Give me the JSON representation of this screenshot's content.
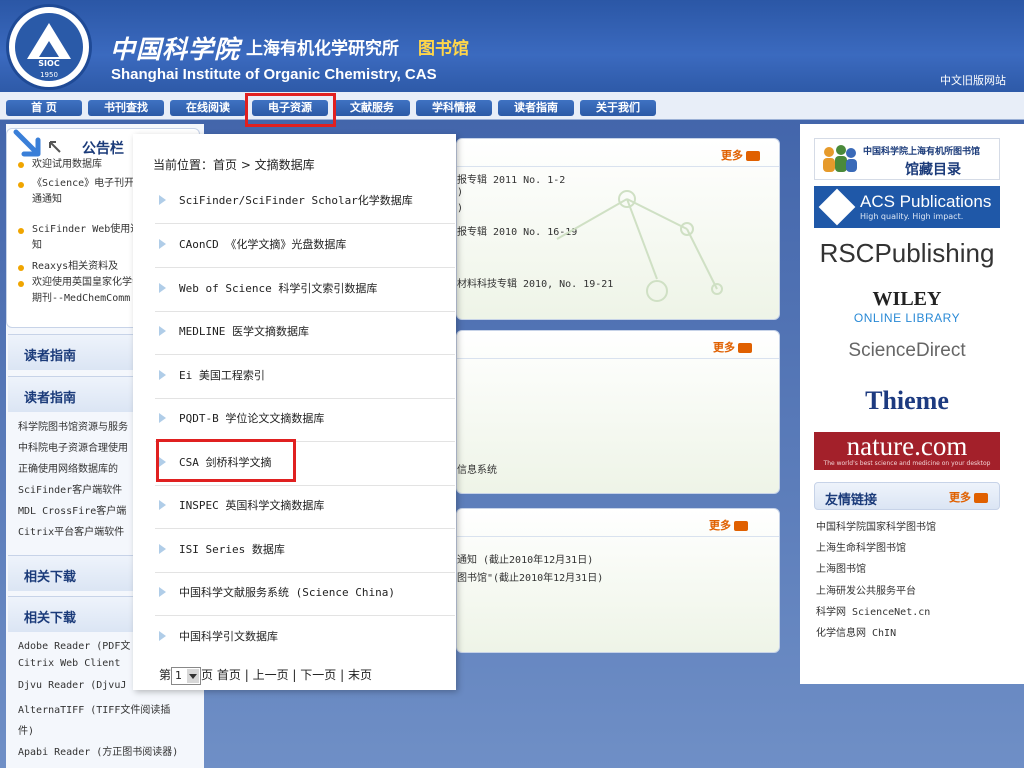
{
  "header": {
    "logo_text": "SIOC",
    "logo_year": "1950",
    "cas_cn": "中国科学院",
    "institute_cn": "上海有机化学研究所",
    "library_cn": "图书馆",
    "institute_en": "Shanghai Institute of Organic Chemistry, CAS",
    "old_site_link": "中文旧版网站"
  },
  "nav": {
    "items": [
      {
        "label": "首 页"
      },
      {
        "label": "书刊查找"
      },
      {
        "label": "在线阅读"
      },
      {
        "label": "电子资源"
      },
      {
        "label": "文献服务"
      },
      {
        "label": "学科情报"
      },
      {
        "label": "读者指南"
      },
      {
        "label": "关于我们"
      }
    ]
  },
  "notice": {
    "title": "公告栏",
    "items": [
      "欢迎试用数据库",
      "《Science》电子刊开通通知",
      "SciFinder Web使用通知",
      "Reaxys相关资料及",
      "欢迎使用英国皇家化学会期刊--MedChemComm"
    ]
  },
  "left_sections": {
    "reader_guide_1": "读者指南",
    "reader_guide_2": "读者指南",
    "guide_links": [
      "科学院图书馆资源与服务",
      "中科院电子资源合理使用",
      "正确使用网络数据库的",
      "SciFinder客户端软件",
      "MDL CrossFire客户端",
      "Citrix平台客户端软件"
    ],
    "downloads_1": "相关下载",
    "downloads_2": "相关下载",
    "download_links": [
      "Adobe Reader (PDF文",
      "Citrix Web Client",
      "Djvu Reader (DjvuJ",
      "AlternaTIFF (TIFF文件阅读插",
      "件)",
      "Apabi Reader (方正图书阅读器)"
    ]
  },
  "overlay": {
    "breadcrumb": "当前位置：首页 > 文摘数据库",
    "databases": [
      "SciFinder/SciFinder Scholar化学数据库",
      "CAonCD 《化学文摘》光盘数据库",
      "Web of Science 科学引文索引数据库",
      "MEDLINE 医学文摘数据库",
      "Ei 美国工程索引",
      "PQDT-B 学位论文文摘数据库",
      "CSA 剑桥科学文摘",
      "INSPEC 英国科学文摘数据库",
      "ISI Series 数据库",
      "中国科学文献服务系统 (Science China)",
      "中国科学引文数据库"
    ],
    "pager": {
      "prefix": "第",
      "page": "1",
      "suffix": "页",
      "first": "首页",
      "prev": "上一页",
      "next": "下一页",
      "last": "末页",
      "sep": "|"
    }
  },
  "middle": {
    "more_label": "更多",
    "panel1_lines": [
      "报专辑 2011 No. 1-2",
      ")",
      ")",
      "报专辑 2010 No. 16-19",
      "材料科技专辑 2010, No. 19-21"
    ],
    "panel2_lines": [
      "信息系统"
    ],
    "panel3_lines": [
      "通知 (截止2010年12月31日)",
      "图书馆\"(截止2010年12月31日)"
    ]
  },
  "right": {
    "catalog_line1": "中国科学院上海有机所图书馆",
    "catalog_line2": "馆藏目录",
    "acs_name": "ACS Publications",
    "acs_tagline": "High quality. High impact.",
    "rsc": "RSCPublishing",
    "wiley_1": "WILEY",
    "wiley_2": "ONLINE LIBRARY",
    "sciencedirect": "ScienceDirect",
    "thieme": "Thieme",
    "nature_1": "nature.com",
    "nature_2": "The world's best science and medicine on your desktop",
    "friend_title": "友情链接",
    "friend_more": "更多",
    "friend_links": [
      "中国科学院国家科学图书馆",
      "上海生命科学图书馆",
      "上海图书馆",
      "上海研发公共服务平台",
      "科学网 ScienceNet.cn",
      "化学信息网 ChIN"
    ]
  },
  "colors": {
    "brand_blue": "#2b57a6",
    "highlight_red": "#e02020",
    "library_gold": "#ffd64a",
    "more_orange": "#e06000"
  }
}
